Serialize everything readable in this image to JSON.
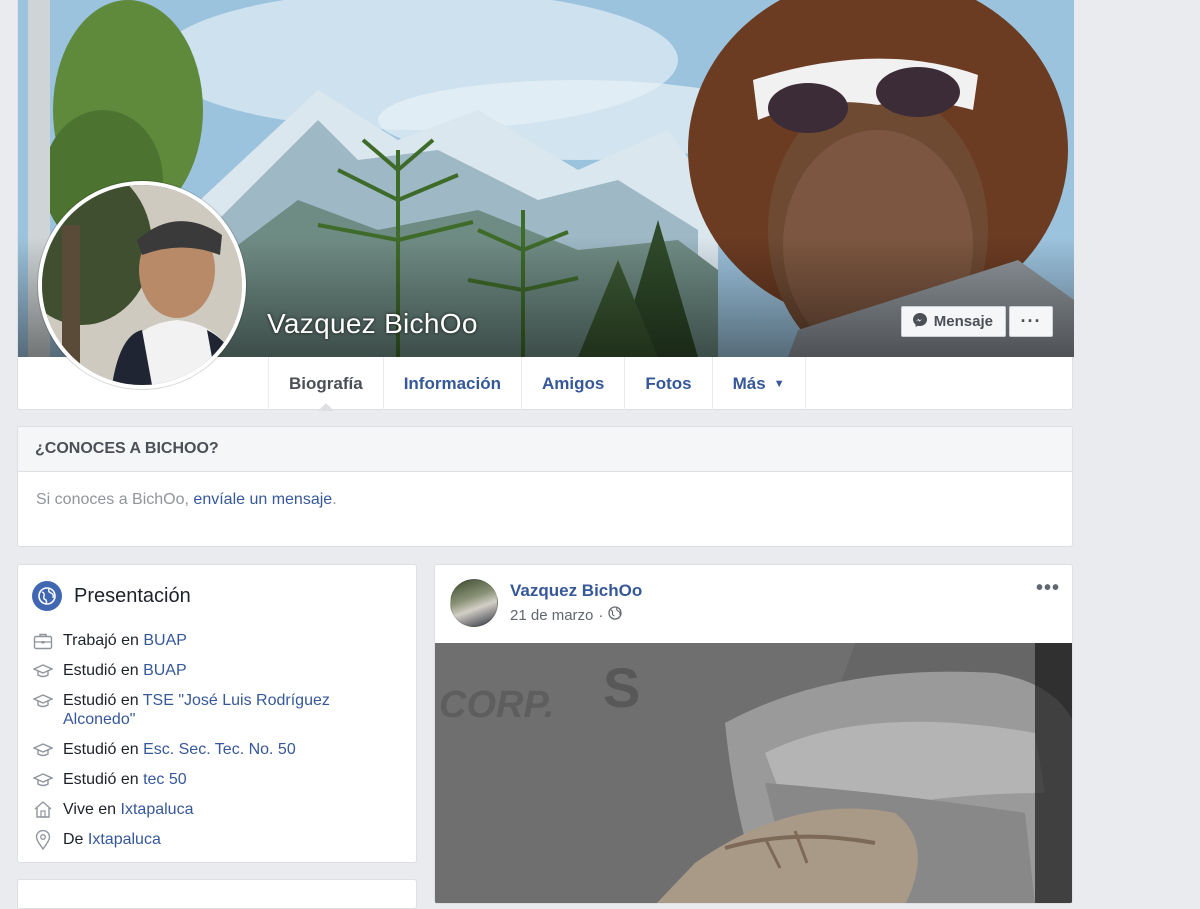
{
  "profile": {
    "name": "Vazquez BichOo",
    "message_button": "Mensaje",
    "more_button": "···"
  },
  "tabs": [
    {
      "label": "Biografía",
      "active": true
    },
    {
      "label": "Información",
      "active": false
    },
    {
      "label": "Amigos",
      "active": false
    },
    {
      "label": "Fotos",
      "active": false
    },
    {
      "label": "Más",
      "active": false
    }
  ],
  "know": {
    "header": "¿CONOCES A BICHOO?",
    "text": "Si conoces a BichOo, ",
    "link": "envíale un mensaje",
    "suffix": "."
  },
  "intro": {
    "title": "Presentación",
    "items": [
      {
        "icon": "briefcase-icon",
        "prefix": "Trabajó en ",
        "link": "BUAP"
      },
      {
        "icon": "graduation-cap-icon",
        "prefix": "Estudió en ",
        "link": "BUAP"
      },
      {
        "icon": "graduation-cap-icon",
        "prefix": "Estudió en ",
        "link": "TSE \"José Luis Rodríguez Alconedo\""
      },
      {
        "icon": "graduation-cap-icon",
        "prefix": "Estudió en ",
        "link": "Esc. Sec. Tec. No. 50"
      },
      {
        "icon": "graduation-cap-icon",
        "prefix": "Estudió en ",
        "link": "tec 50"
      },
      {
        "icon": "home-icon",
        "prefix": "Vive en ",
        "link": "Ixtapaluca"
      },
      {
        "icon": "location-pin-icon",
        "prefix": "De ",
        "link": "Ixtapaluca"
      }
    ]
  },
  "post": {
    "author": "Vazquez BichOo",
    "date": "21 de marzo",
    "separator": "·",
    "menu": "•••"
  },
  "photo_text": {
    "corp": "CORP.",
    "s": "S"
  },
  "colors": {
    "link": "#365899",
    "brand": "#4267b2",
    "background": "#e9ebee"
  }
}
